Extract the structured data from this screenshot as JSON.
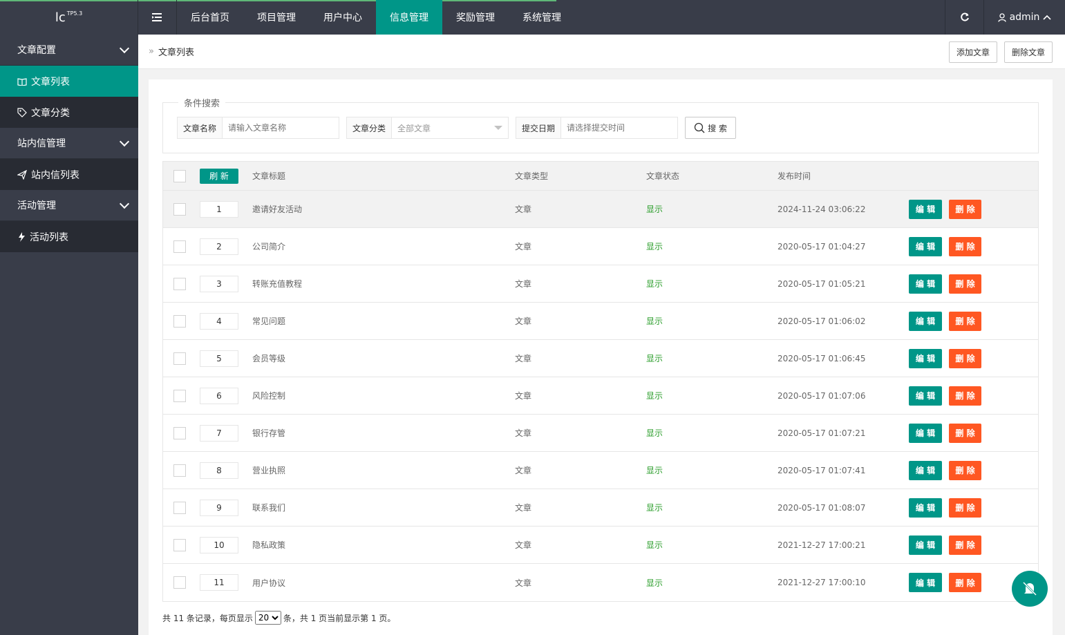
{
  "logo": {
    "text": "lc",
    "sup": "TP5.3"
  },
  "topnav": [
    {
      "label": "后台首页",
      "active": false
    },
    {
      "label": "项目管理",
      "active": false
    },
    {
      "label": "用户中心",
      "active": false
    },
    {
      "label": "信息管理",
      "active": true
    },
    {
      "label": "奖励管理",
      "active": false
    },
    {
      "label": "系统管理",
      "active": false
    }
  ],
  "user": {
    "name": "admin"
  },
  "sidebar": {
    "groups": [
      {
        "label": "文章配置",
        "items": [
          {
            "label": "文章列表",
            "icon": "book-icon",
            "active": true
          },
          {
            "label": "文章分类",
            "icon": "tag-icon",
            "active": false
          }
        ]
      },
      {
        "label": "站内信管理",
        "items": [
          {
            "label": "站内信列表",
            "icon": "send-icon",
            "active": false
          }
        ]
      },
      {
        "label": "活动管理",
        "items": [
          {
            "label": "活动列表",
            "icon": "activity-icon",
            "active": false
          }
        ]
      }
    ]
  },
  "breadcrumb": {
    "current": "文章列表"
  },
  "actions": {
    "add": "添加文章",
    "delete": "删除文章"
  },
  "search": {
    "legend": "条件搜索",
    "name_label": "文章名称",
    "name_placeholder": "请输入文章名称",
    "category_label": "文章分类",
    "category_value": "全部文章",
    "date_label": "提交日期",
    "date_placeholder": "请选择提交时间",
    "button": "搜 索"
  },
  "table": {
    "refresh": "刷 新",
    "headers": {
      "title": "文章标题",
      "type": "文章类型",
      "status": "文章状态",
      "time": "发布时间"
    },
    "edit_label": "编 辑",
    "delete_label": "删 除",
    "rows": [
      {
        "sort": "1",
        "title": "邀请好友活动",
        "type": "文章",
        "status": "显示",
        "time": "2024-11-24 03:06:22"
      },
      {
        "sort": "2",
        "title": "公司简介",
        "type": "文章",
        "status": "显示",
        "time": "2020-05-17 01:04:27"
      },
      {
        "sort": "3",
        "title": "转账充值教程",
        "type": "文章",
        "status": "显示",
        "time": "2020-05-17 01:05:21"
      },
      {
        "sort": "4",
        "title": "常见问题",
        "type": "文章",
        "status": "显示",
        "time": "2020-05-17 01:06:02"
      },
      {
        "sort": "5",
        "title": "会员等级",
        "type": "文章",
        "status": "显示",
        "time": "2020-05-17 01:06:45"
      },
      {
        "sort": "6",
        "title": "风险控制",
        "type": "文章",
        "status": "显示",
        "time": "2020-05-17 01:07:06"
      },
      {
        "sort": "7",
        "title": "银行存管",
        "type": "文章",
        "status": "显示",
        "time": "2020-05-17 01:07:21"
      },
      {
        "sort": "8",
        "title": "营业执照",
        "type": "文章",
        "status": "显示",
        "time": "2020-05-17 01:07:41"
      },
      {
        "sort": "9",
        "title": "联系我们",
        "type": "文章",
        "status": "显示",
        "time": "2020-05-17 01:08:07"
      },
      {
        "sort": "10",
        "title": "隐私政策",
        "type": "文章",
        "status": "显示",
        "time": "2021-12-27 17:00:21"
      },
      {
        "sort": "11",
        "title": "用户协议",
        "type": "文章",
        "status": "显示",
        "time": "2021-12-27 17:00:10"
      }
    ]
  },
  "pager": {
    "prefix": "共 11 条记录，每页显示",
    "per_page": "20",
    "suffix": "条，共 1 页当前显示第 1 页。"
  },
  "colors": {
    "accent": "#009688",
    "danger": "#ff5722",
    "dark": "#393d49",
    "status_on": "#2a9d2a"
  }
}
